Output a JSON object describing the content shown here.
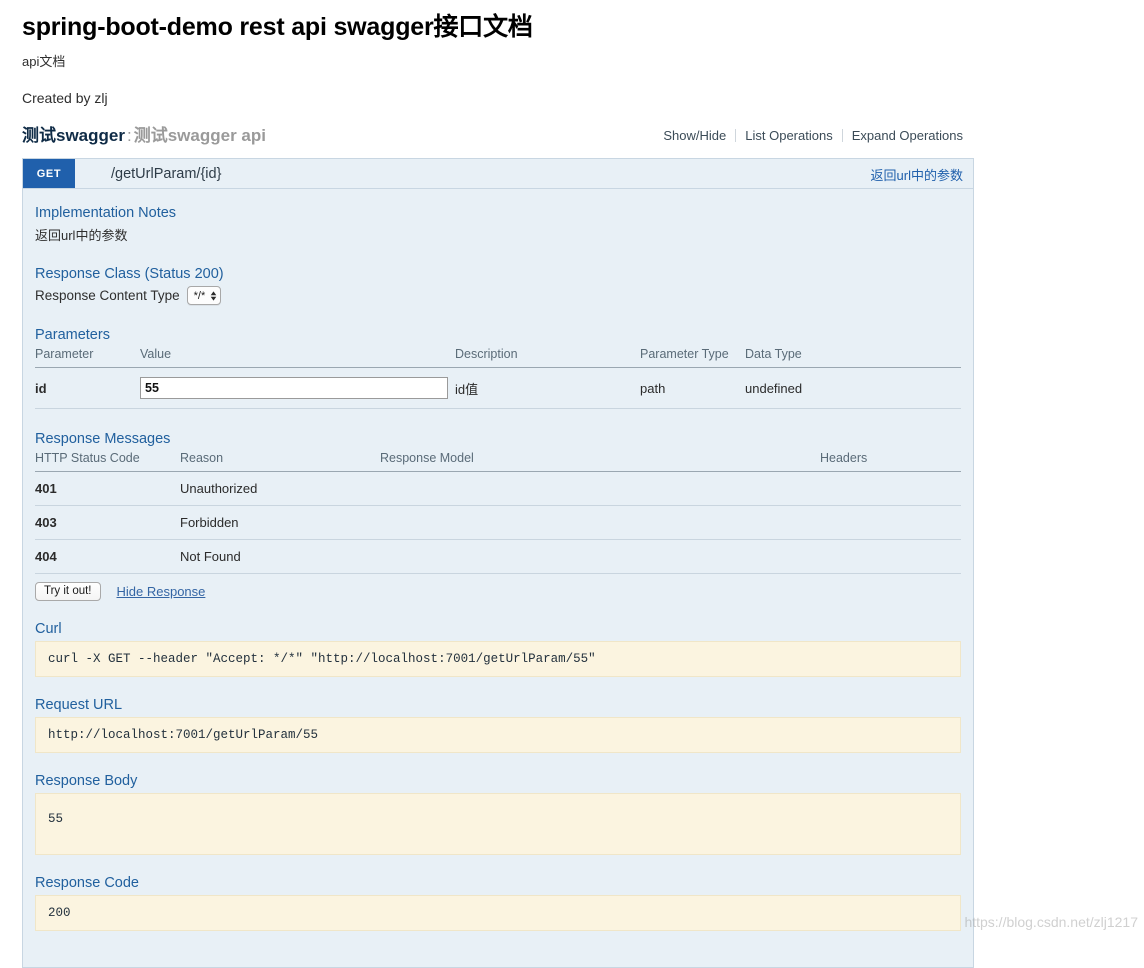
{
  "header": {
    "title": "spring-boot-demo rest api swagger接口文档",
    "description": "api文档",
    "created_by": "Created by zlj"
  },
  "resource": {
    "name": "测试swagger",
    "separator": ":",
    "subtitle": "测试swagger api",
    "options": [
      {
        "label": "Show/Hide"
      },
      {
        "label": "List Operations"
      },
      {
        "label": "Expand Operations"
      }
    ]
  },
  "operation": {
    "method": "GET",
    "path": "/getUrlParam/{id}",
    "summary": "返回url中的参数",
    "implementation_notes_title": "Implementation Notes",
    "implementation_notes": "返回url中的参数",
    "response_class_title": "Response Class (Status 200)",
    "response_content_type_label": "Response Content Type",
    "response_content_type_value": "*/*",
    "parameters_title": "Parameters",
    "parameters_headers": [
      "Parameter",
      "Value",
      "Description",
      "Parameter Type",
      "Data Type"
    ],
    "parameters": [
      {
        "name": "id",
        "value": "55",
        "description": "id值",
        "parameter_type": "path",
        "data_type": "undefined"
      }
    ],
    "response_messages_title": "Response Messages",
    "response_messages_headers": [
      "HTTP Status Code",
      "Reason",
      "Response Model",
      "Headers"
    ],
    "response_messages": [
      {
        "code": "401",
        "reason": "Unauthorized",
        "model": "",
        "headers": ""
      },
      {
        "code": "403",
        "reason": "Forbidden",
        "model": "",
        "headers": ""
      },
      {
        "code": "404",
        "reason": "Not Found",
        "model": "",
        "headers": ""
      }
    ],
    "try_it_out_label": "Try it out!",
    "hide_response_label": "Hide Response",
    "curl_title": "Curl",
    "curl": "curl -X GET --header \"Accept: */*\" \"http://localhost:7001/getUrlParam/55\"",
    "request_url_title": "Request URL",
    "request_url": "http://localhost:7001/getUrlParam/55",
    "response_body_title": "Response Body",
    "response_body": "55",
    "response_code_title": "Response Code",
    "response_code": "200"
  },
  "watermark": "https://blog.csdn.net/zlj1217",
  "colors": {
    "method_get": "#2060ac",
    "section_heading": "#21609e",
    "operation_bg": "#e8f0f6",
    "code_bg": "#fbf4e0",
    "link": "#3465a4"
  }
}
